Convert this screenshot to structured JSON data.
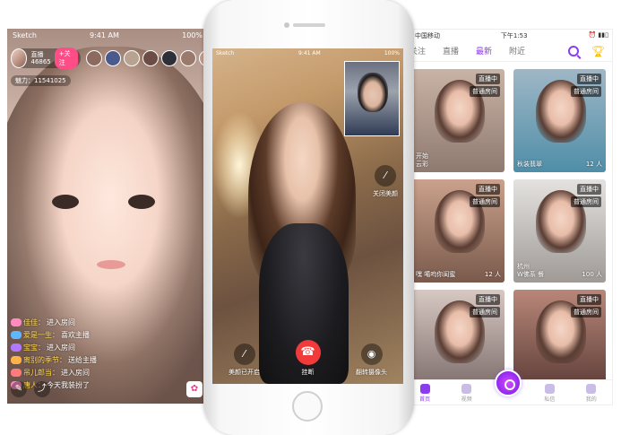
{
  "left_screen": {
    "status": {
      "carrier": "Sketch",
      "time": "9:41 AM",
      "battery": "100%"
    },
    "host": {
      "name": "直播",
      "id": "46865",
      "follow_label": "+关注"
    },
    "viewer_colors": [
      "#8c6a60",
      "#4a5a8a",
      "#b7a38f",
      "#6b4d45",
      "#2f2f3a",
      "#9a7a6c",
      "#c2a090"
    ],
    "close_icon": "close-icon",
    "charm": "魅力：11541025",
    "chat": [
      {
        "name": "佳佳：",
        "text": "进入房间",
        "lvl_color": "#ff8ac0"
      },
      {
        "name": "爱是一生：",
        "text": "喜欢主播",
        "lvl_color": "#5fb8ff"
      },
      {
        "name": "宝宝：",
        "text": "进入房间",
        "lvl_color": "#b278ff"
      },
      {
        "name": "离别的季节：",
        "text": "送给主播",
        "lvl_color": "#ffb347"
      },
      {
        "name": "吊儿郎当：",
        "text": "进入房间",
        "lvl_color": "#ff7a7a"
      },
      {
        "name": "唐人：",
        "text": "今天我装扮了",
        "lvl_color": "#ff8ac0"
      }
    ],
    "bottom_icons": [
      "chat-icon",
      "share-icon",
      "gift-icon"
    ]
  },
  "phone": {
    "status": {
      "carrier": "Sketch",
      "time": "9:41 AM",
      "battery": "100%"
    },
    "side": {
      "label": "关闭美颜"
    },
    "bottom": [
      {
        "label": "美颜已开启"
      },
      {
        "label": "挂断"
      },
      {
        "label": "翻转摄像头"
      }
    ]
  },
  "right_screen": {
    "status": {
      "carrier": "中国移动",
      "time": "下午1:53"
    },
    "tabs": [
      "关注",
      "直播",
      "最新",
      "附近"
    ],
    "active_tab": 2,
    "cards": [
      {
        "live": "直播中",
        "room": "普通房间",
        "cap": "开始\n云彩",
        "count": "",
        "bg": "linear-gradient(180deg,#c9b3a6 0%,#8f7a70 100%)"
      },
      {
        "live": "直播中",
        "room": "普通房间",
        "cap": "秋装翡翠",
        "count": "12 人",
        "bg": "linear-gradient(180deg,#9fb7c6 0%,#4f8ea8 100%)"
      },
      {
        "live": "直播中",
        "room": "普通房间",
        "cap": "嘿   噶呜你闺蜜",
        "count": "12 人",
        "bg": "linear-gradient(180deg,#caa18c 0%,#7a5a4c 100%)"
      },
      {
        "live": "直播中",
        "room": "普通房间",
        "cap": "杭州\nW佛系 餐",
        "count": "100 人",
        "bg": "linear-gradient(180deg,#e4e2e0 0%,#9f9a96 100%)"
      },
      {
        "live": "直播中",
        "room": "普通房间",
        "cap": "",
        "count": "",
        "bg": "linear-gradient(180deg,#d7c8c2 0%,#7a6b69 100%)"
      },
      {
        "live": "直播中",
        "room": "普通房间",
        "cap": "",
        "count": "",
        "bg": "linear-gradient(180deg,#b98779 0%,#5a3b36 100%)"
      }
    ],
    "tabbar": [
      {
        "label": "首页"
      },
      {
        "label": "视频"
      },
      {
        "label": ""
      },
      {
        "label": "私信"
      },
      {
        "label": "我的"
      }
    ]
  }
}
